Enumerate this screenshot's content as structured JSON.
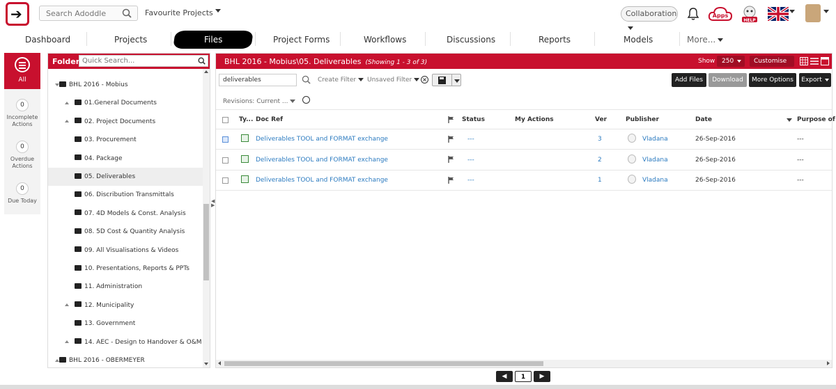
{
  "header": {
    "search_placeholder": "Search Adoddle",
    "favourite_label": "Favourite Projects",
    "collaboration_label": "Collaboration",
    "apps_label": "Apps",
    "help_label": "HELP"
  },
  "nav": {
    "tabs": [
      "Dashboard",
      "Projects",
      "Files",
      "Project Forms",
      "Workflows",
      "Discussions",
      "Reports",
      "Models",
      "More..."
    ]
  },
  "leftbar": {
    "all_label": "All",
    "stats": [
      {
        "count": "0",
        "label": "Incomplete Actions"
      },
      {
        "count": "0",
        "label": "Overdue Actions"
      },
      {
        "count": "0",
        "label": "Due Today"
      }
    ]
  },
  "folders": {
    "title": "Folders",
    "search_placeholder": "Quick Search...",
    "items": [
      {
        "label": "BHL 2016 - Mobius",
        "level": 0,
        "expand": "down",
        "selected": false
      },
      {
        "label": "01.General Documents",
        "level": 1,
        "expand": "up",
        "selected": false
      },
      {
        "label": "02. Project Documents",
        "level": 1,
        "expand": "up",
        "selected": false
      },
      {
        "label": "03. Procurement",
        "level": 1,
        "expand": "none",
        "selected": false
      },
      {
        "label": "04. Package",
        "level": 1,
        "expand": "none",
        "selected": false
      },
      {
        "label": "05. Deliverables",
        "level": 1,
        "expand": "none",
        "selected": true
      },
      {
        "label": "06. Discribution Transmittals",
        "level": 1,
        "expand": "none",
        "selected": false
      },
      {
        "label": "07. 4D Models & Const. Analysis",
        "level": 1,
        "expand": "none",
        "selected": false
      },
      {
        "label": "08. 5D Cost & Quantity Analysis",
        "level": 1,
        "expand": "none",
        "selected": false
      },
      {
        "label": "09. All Visualisations & Videos",
        "level": 1,
        "expand": "none",
        "selected": false
      },
      {
        "label": "10. Presentations, Reports & PPTs",
        "level": 1,
        "expand": "none",
        "selected": false
      },
      {
        "label": "11. Administration",
        "level": 1,
        "expand": "none",
        "selected": false
      },
      {
        "label": "12. Municipality",
        "level": 1,
        "expand": "up",
        "selected": false
      },
      {
        "label": "13. Government",
        "level": 1,
        "expand": "none",
        "selected": false
      },
      {
        "label": "14. AEC - Design to Handover & O&M",
        "level": 1,
        "expand": "up",
        "selected": false
      },
      {
        "label": "BHL 2016 - OBERMEYER",
        "level": 0,
        "expand": "up",
        "selected": false
      }
    ]
  },
  "main": {
    "path": "BHL 2016 - Mobius\\05. Deliverables",
    "showing": "(Showing 1 - 3 of 3)",
    "show_label": "Show",
    "page_size": "250",
    "customise_label": "Customise",
    "search_value": "deliverables",
    "create_filter": "Create Filter",
    "unsaved_filter": "Unsaved Filter",
    "buttons": {
      "add_files": "Add Files",
      "download": "Download",
      "more_options": "More  Options",
      "export": "Export"
    },
    "revisions": "Revisions: Current ...",
    "columns": [
      "Ty...",
      "Doc Ref",
      "Status",
      "My Actions",
      "Ver",
      "Publisher",
      "Date",
      "Purpose of Is"
    ],
    "rows": [
      {
        "doc_ref": "Deliverables TOOL and FORMAT exchange",
        "status": "---",
        "ver": "3",
        "publisher": "Vladana",
        "date": "26-Sep-2016",
        "purpose": "---",
        "checked": true
      },
      {
        "doc_ref": "Deliverables TOOL and FORMAT exchange",
        "status": "---",
        "ver": "2",
        "publisher": "Vladana",
        "date": "26-Sep-2016",
        "purpose": "---",
        "checked": false
      },
      {
        "doc_ref": "Deliverables TOOL and FORMAT exchange",
        "status": "---",
        "ver": "1",
        "publisher": "Vladana",
        "date": "26-Sep-2016",
        "purpose": "---",
        "checked": false
      }
    ]
  },
  "pager": {
    "current_page": "1"
  },
  "colors": {
    "brand_red": "#c8102e",
    "link_blue": "#2c7bc0"
  }
}
